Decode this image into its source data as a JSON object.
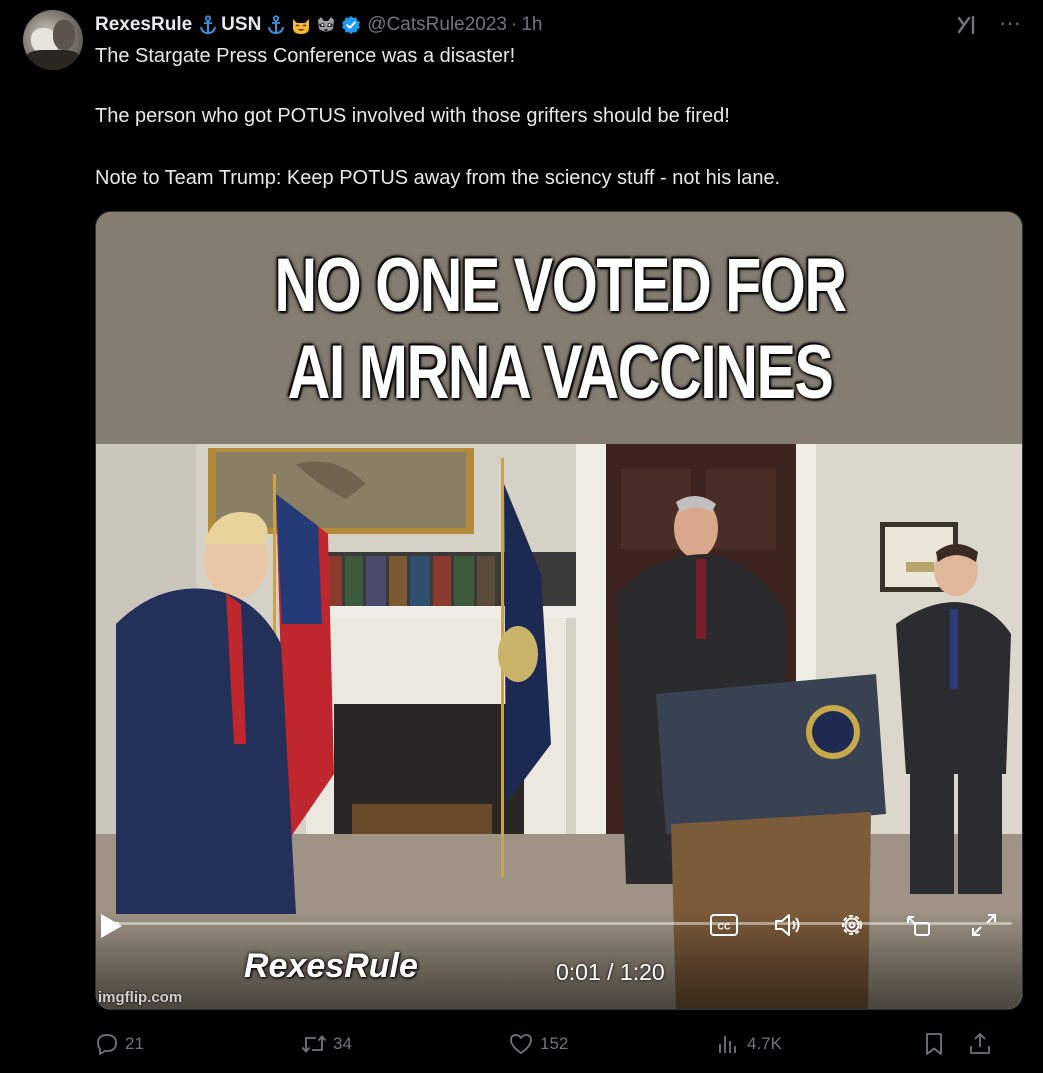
{
  "author": {
    "display_name": "RexesRule",
    "usn_label": "USN",
    "handle": "@CatsRule2023",
    "separator": "·",
    "time": "1h"
  },
  "tweet": {
    "line1": "The Stargate Press Conference was a disaster!",
    "line2": "The person who got POTUS involved with those grifters should be fired!",
    "line3": "Note to Team Trump:  Keep POTUS away from the sciency stuff - not his lane."
  },
  "media": {
    "meme_line1": "NO ONE VOTED FOR",
    "meme_line2": "AI MRNA VACCINES",
    "watermark": "RexesRule",
    "source": "imgflip.com",
    "time_display": "0:01 / 1:20",
    "progress": 0.0125
  },
  "actions": {
    "replies": "21",
    "reposts": "34",
    "likes": "152",
    "views": "4.7K"
  },
  "colors": {
    "background": "#000000",
    "text": "#e7e9ea",
    "muted": "#71767b",
    "verified": "#1d9bf0",
    "anchor": "#3b94d9"
  },
  "icons": {
    "reply": "reply-icon",
    "repost": "repost-icon",
    "like": "heart-icon",
    "views": "views-icon",
    "bookmark": "bookmark-icon",
    "share": "share-icon",
    "grok": "grok-icon",
    "more": "more-icon"
  }
}
